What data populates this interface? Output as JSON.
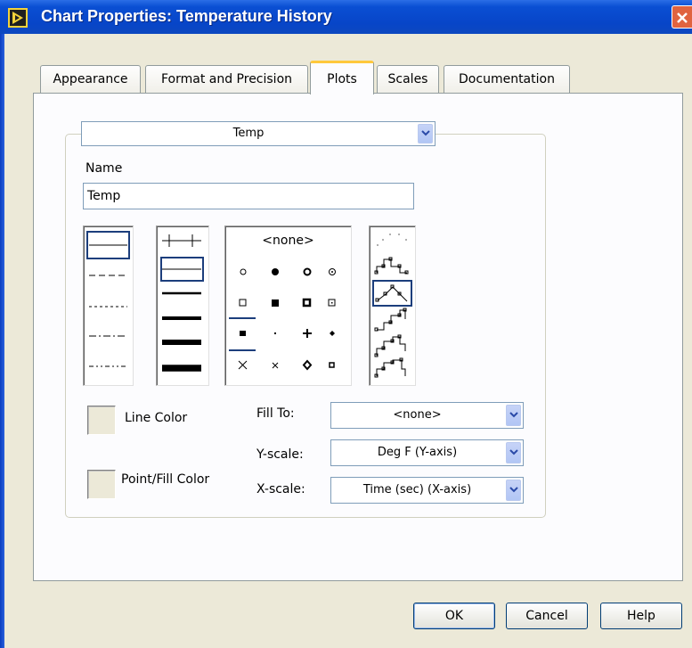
{
  "window": {
    "title": "Chart Properties: Temperature History"
  },
  "tabs": [
    {
      "label": "Appearance",
      "active": false
    },
    {
      "label": "Format and Precision",
      "active": false
    },
    {
      "label": "Plots",
      "active": true
    },
    {
      "label": "Scales",
      "active": false
    },
    {
      "label": "Documentation",
      "active": false
    }
  ],
  "plot_selector": {
    "value": "Temp"
  },
  "name_field": {
    "label": "Name",
    "value": "Temp"
  },
  "point_style": {
    "none_label": "<none>"
  },
  "line_color": {
    "label": "Line Color"
  },
  "point_fill_color": {
    "label": "Point/Fill Color"
  },
  "fill_to": {
    "label": "Fill To:",
    "value": "<none>"
  },
  "y_scale": {
    "label": "Y-scale:",
    "value": "Deg F (Y-axis)"
  },
  "x_scale": {
    "label": "X-scale:",
    "value": "Time (sec) (X-axis)"
  },
  "buttons": {
    "ok": "OK",
    "cancel": "Cancel",
    "help": "Help"
  },
  "colors": {
    "title_bar": "#0a4fd3",
    "dialog_bg": "#ece9d8",
    "active_tab_accent": "#ffc83c",
    "selection": "#1c3e7c"
  }
}
